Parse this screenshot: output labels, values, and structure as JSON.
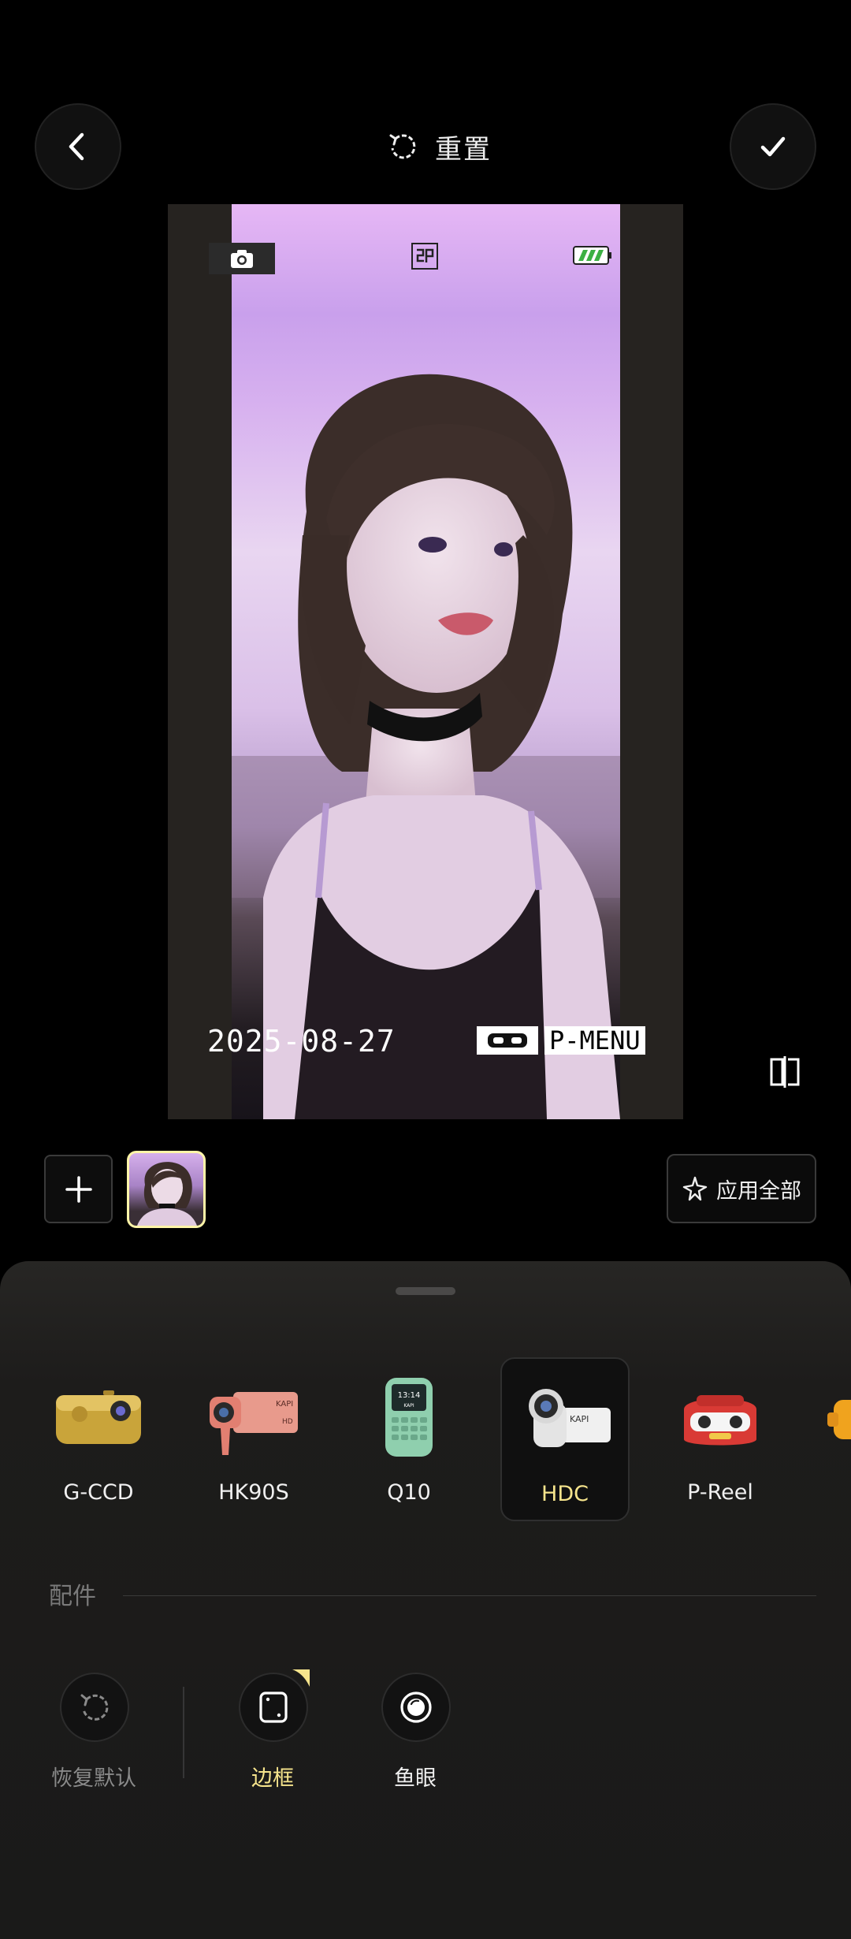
{
  "header": {
    "reset_label": "重置"
  },
  "preview": {
    "date_stamp": "2025-08-27",
    "mode_label": "P-MENU"
  },
  "toolbar": {
    "apply_all_label": "应用全部"
  },
  "cameras": {
    "items": [
      {
        "label": "G-CCD",
        "selected": false
      },
      {
        "label": "HK90S",
        "selected": false
      },
      {
        "label": "Q10",
        "selected": false
      },
      {
        "label": "HDC",
        "selected": true
      },
      {
        "label": "P-Reel",
        "selected": false
      }
    ]
  },
  "q10_screen": {
    "time": "13:14",
    "brand": "KAPI"
  },
  "hk90s_device": {
    "brand": "KAPI",
    "tag": "HD"
  },
  "hdc_device": {
    "brand": "KAPI"
  },
  "accessories": {
    "section_label": "配件",
    "items": [
      {
        "label": "恢复默认"
      },
      {
        "label": "边框"
      },
      {
        "label": "鱼眼"
      }
    ]
  },
  "colors": {
    "accent": "#f6e48c",
    "selected_thumb_border": "#fff5a8"
  }
}
